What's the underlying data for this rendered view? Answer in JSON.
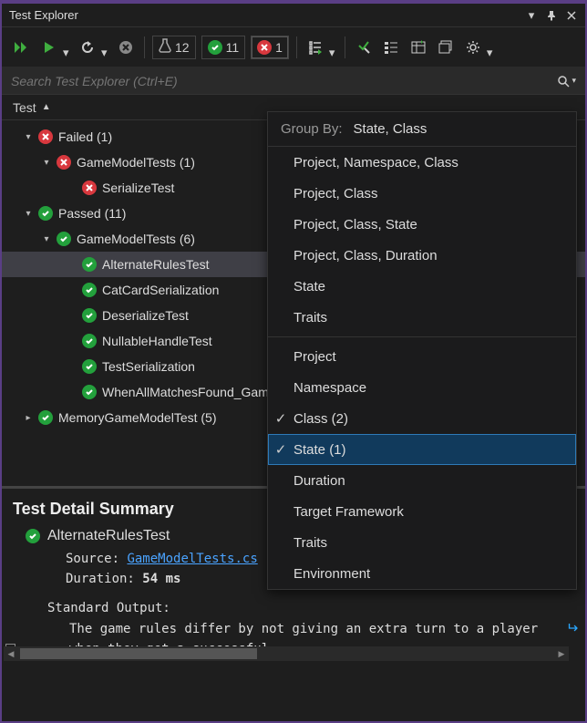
{
  "window": {
    "title": "Test Explorer"
  },
  "toolbar": {
    "counters": {
      "total": "12",
      "passed": "11",
      "failed": "1"
    }
  },
  "search": {
    "placeholder": "Search Test Explorer (Ctrl+E)"
  },
  "listHeader": {
    "label": "Test"
  },
  "tree": [
    {
      "indent": 18,
      "arrow": "▾",
      "status": "fail",
      "label": "Failed  (1)"
    },
    {
      "indent": 38,
      "arrow": "▾",
      "status": "fail",
      "label": "GameModelTests (1)"
    },
    {
      "indent": 66,
      "arrow": "",
      "status": "fail",
      "label": "SerializeTest"
    },
    {
      "indent": 18,
      "arrow": "▾",
      "status": "pass",
      "label": "Passed  (11)"
    },
    {
      "indent": 38,
      "arrow": "▾",
      "status": "pass",
      "label": "GameModelTests (6)"
    },
    {
      "indent": 66,
      "arrow": "",
      "status": "pass",
      "label": "AlternateRulesTest",
      "selected": true
    },
    {
      "indent": 66,
      "arrow": "",
      "status": "pass",
      "label": "CatCardSerialization"
    },
    {
      "indent": 66,
      "arrow": "",
      "status": "pass",
      "label": "DeserializeTest"
    },
    {
      "indent": 66,
      "arrow": "",
      "status": "pass",
      "label": "NullableHandleTest"
    },
    {
      "indent": 66,
      "arrow": "",
      "status": "pass",
      "label": "TestSerialization"
    },
    {
      "indent": 66,
      "arrow": "",
      "status": "pass",
      "label": "WhenAllMatchesFound_GameIsWon"
    },
    {
      "indent": 18,
      "arrow": "▸",
      "status": "pass",
      "label": "MemoryGameModelTest (5)"
    }
  ],
  "detail": {
    "heading": "Test Detail Summary",
    "testName": "AlternateRulesTest",
    "sourceLabel": "Source:",
    "sourceLink": "GameModelTests.cs",
    "durationLabel": "Duration:",
    "durationValue": "54 ms",
    "stdoutLabel": "Standard Output:",
    "stdoutBody": "The game rules differ by not giving an extra turn to a player when they get a successful"
  },
  "menu": {
    "headerLabel": "Group By:",
    "headerValue": "State, Class",
    "group1": [
      "Project, Namespace, Class",
      "Project, Class",
      "Project, Class, State",
      "Project, Class, Duration",
      "State",
      "Traits"
    ],
    "group2": [
      {
        "label": "Project",
        "checked": false
      },
      {
        "label": "Namespace",
        "checked": false
      },
      {
        "label": "Class (2)",
        "checked": true
      },
      {
        "label": "State (1)",
        "checked": true,
        "selected": true
      },
      {
        "label": "Duration",
        "checked": false
      },
      {
        "label": "Target Framework",
        "checked": false
      },
      {
        "label": "Traits",
        "checked": false
      },
      {
        "label": "Environment",
        "checked": false
      }
    ]
  }
}
